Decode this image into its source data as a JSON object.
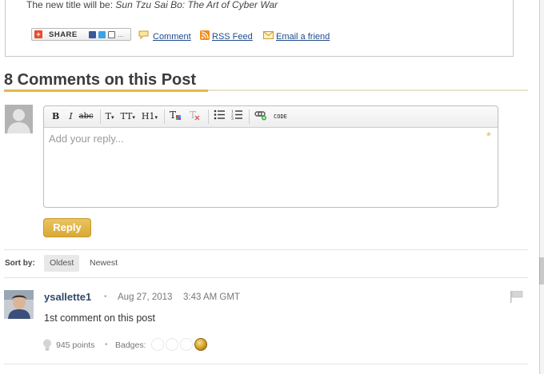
{
  "post": {
    "title_prefix": "The new title will be:",
    "title_italic": "Sun Tzu Sai Bo: The Art of Cyber War",
    "share_label": "SHARE",
    "links": {
      "comment": "Comment",
      "rss": "RSS Feed",
      "email": "Email a friend"
    }
  },
  "comments_section": {
    "heading": "8 Comments on this Post"
  },
  "editor": {
    "toolbar": {
      "bold": "B",
      "italic": "I",
      "strike": "abc",
      "font_size": "T",
      "font_scale": "TT",
      "heading": "H1",
      "code": "CODE"
    },
    "placeholder": "Add your reply...",
    "required_marker": "*"
  },
  "reply_button": "Reply",
  "sort": {
    "label": "Sort by:",
    "options": [
      "Oldest",
      "Newest"
    ],
    "selected": "Oldest"
  },
  "comment": {
    "author": "ysallette1",
    "date": "Aug 27, 2013",
    "time": "3:43 AM GMT",
    "body": "1st comment on this post",
    "points": "945 points",
    "badges_label": "Badges:"
  },
  "colors": {
    "accent": "#e2b94a",
    "link": "#1e4a8a",
    "author": "#324a6b"
  }
}
